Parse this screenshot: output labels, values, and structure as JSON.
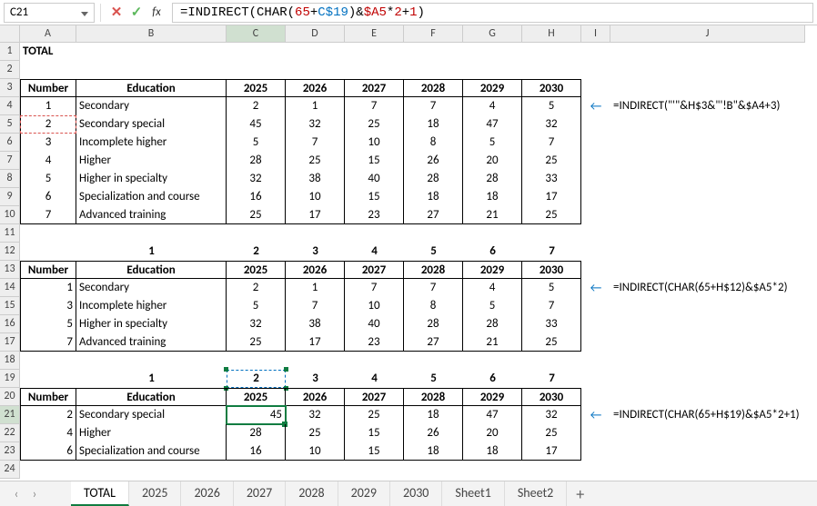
{
  "namebox": "C21",
  "formula_display": "=INDIRECT(CHAR(65+C$19)&$A5*2+1)",
  "columns": [
    "A",
    "B",
    "C",
    "D",
    "E",
    "F",
    "G",
    "H",
    "I",
    "J"
  ],
  "row_count": 24,
  "block1": {
    "total_label": "TOTAL",
    "header_number": "Number",
    "header_education": "Education",
    "years": [
      "2025",
      "2026",
      "2027",
      "2028",
      "2029",
      "2030"
    ],
    "rows": [
      {
        "n": "1",
        "edu": "Secondary",
        "v": [
          "2",
          "1",
          "7",
          "7",
          "4",
          "5"
        ]
      },
      {
        "n": "2",
        "edu": "Secondary special",
        "v": [
          "45",
          "32",
          "25",
          "18",
          "47",
          "32"
        ]
      },
      {
        "n": "3",
        "edu": "Incomplete higher",
        "v": [
          "5",
          "7",
          "10",
          "8",
          "5",
          "7"
        ]
      },
      {
        "n": "4",
        "edu": "Higher",
        "v": [
          "28",
          "25",
          "15",
          "26",
          "20",
          "25"
        ]
      },
      {
        "n": "5",
        "edu": "Higher in specialty",
        "v": [
          "32",
          "38",
          "40",
          "28",
          "28",
          "33"
        ]
      },
      {
        "n": "6",
        "edu": "Specialization and course",
        "v": [
          "16",
          "10",
          "15",
          "18",
          "18",
          "17"
        ]
      },
      {
        "n": "7",
        "edu": "Advanced training",
        "v": [
          "25",
          "17",
          "23",
          "27",
          "21",
          "25"
        ]
      }
    ]
  },
  "block2": {
    "index_row": [
      "1",
      "2",
      "3",
      "4",
      "5",
      "6",
      "7"
    ],
    "header_number": "Number",
    "header_education": "Education",
    "years": [
      "2025",
      "2026",
      "2027",
      "2028",
      "2029",
      "2030"
    ],
    "rows": [
      {
        "n": "1",
        "edu": "Secondary",
        "v": [
          "2",
          "1",
          "7",
          "7",
          "4",
          "5"
        ]
      },
      {
        "n": "3",
        "edu": "Incomplete higher",
        "v": [
          "5",
          "7",
          "10",
          "8",
          "5",
          "7"
        ]
      },
      {
        "n": "5",
        "edu": "Higher in specialty",
        "v": [
          "32",
          "38",
          "40",
          "28",
          "28",
          "33"
        ]
      },
      {
        "n": "7",
        "edu": "Advanced training",
        "v": [
          "25",
          "17",
          "23",
          "27",
          "21",
          "25"
        ]
      }
    ]
  },
  "block3": {
    "index_row": [
      "1",
      "2",
      "3",
      "4",
      "5",
      "6",
      "7"
    ],
    "header_number": "Number",
    "header_education": "Education",
    "years": [
      "2025",
      "2026",
      "2027",
      "2028",
      "2029",
      "2030"
    ],
    "rows": [
      {
        "n": "2",
        "edu": "Secondary special",
        "v": [
          "45",
          "32",
          "25",
          "18",
          "47",
          "32"
        ]
      },
      {
        "n": "4",
        "edu": "Higher",
        "v": [
          "28",
          "25",
          "15",
          "26",
          "20",
          "25"
        ]
      },
      {
        "n": "6",
        "edu": "Specialization and course",
        "v": [
          "16",
          "10",
          "15",
          "18",
          "18",
          "17"
        ]
      }
    ]
  },
  "hints": {
    "h1_arrow": "←",
    "h1": "=INDIRECT(\"'\"&H$3&\"'!B\"&$A4+3)",
    "h2_arrow": "←",
    "h2": "=INDIRECT(CHAR(65+H$12)&$A5*2)",
    "h3_arrow": "←",
    "h3": "=INDIRECT(CHAR(65+H$19)&$A5*2+1)"
  },
  "tabs": [
    "TOTAL",
    "2025",
    "2026",
    "2027",
    "2028",
    "2029",
    "2030",
    "Sheet1",
    "Sheet2"
  ],
  "active_tab": "TOTAL",
  "icons": {
    "cancel": "✕",
    "confirm": "✓",
    "fx": "fx",
    "prev": "‹",
    "next": "›",
    "add": "+",
    "cursor": "↖"
  }
}
